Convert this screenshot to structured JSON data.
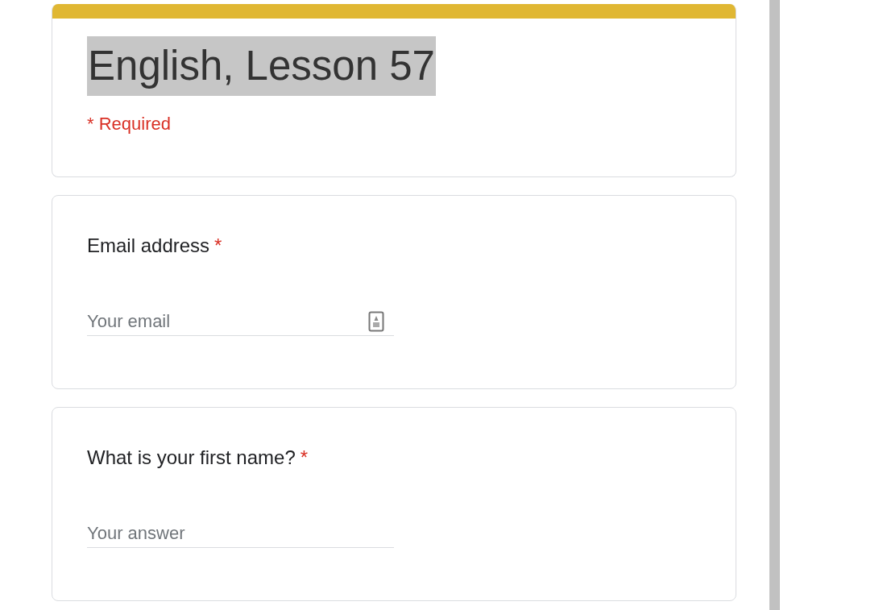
{
  "header": {
    "title": "English, Lesson 57",
    "title_selected": true,
    "required_note": "* Required"
  },
  "questions": [
    {
      "label": "Email address",
      "required_mark": "*",
      "placeholder": "Your email",
      "kind": "email"
    },
    {
      "label": "What is your first name?",
      "required_mark": "*",
      "placeholder": "Your answer",
      "kind": "text"
    }
  ]
}
